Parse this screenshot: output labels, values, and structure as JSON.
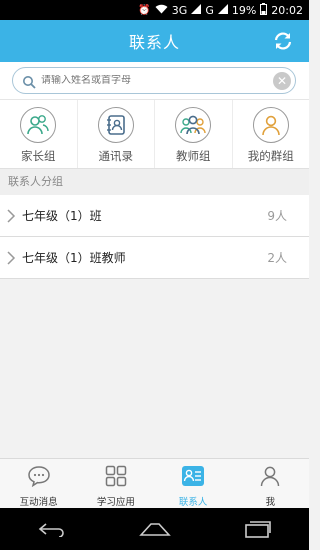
{
  "status": {
    "signal1": "3G",
    "signal2": "G",
    "battery": "19%",
    "time": "20:02"
  },
  "header": {
    "title": "联系人"
  },
  "search": {
    "placeholder": "请输入姓名或首字母",
    "value": ""
  },
  "categories": [
    {
      "label": "家长组",
      "icon": "parents-group-icon"
    },
    {
      "label": "通讯录",
      "icon": "address-book-icon"
    },
    {
      "label": "教师组",
      "icon": "teachers-group-icon"
    },
    {
      "label": "我的群组",
      "icon": "my-group-icon"
    }
  ],
  "section": {
    "title": "联系人分组"
  },
  "groups": [
    {
      "name": "七年级（1）班",
      "count": "9人"
    },
    {
      "name": "七年级（1）班教师",
      "count": "2人"
    }
  ],
  "tabs": [
    {
      "label": "互动消息",
      "icon": "chat-bubble-icon"
    },
    {
      "label": "学习应用",
      "icon": "apps-grid-icon"
    },
    {
      "label": "联系人",
      "icon": "contact-card-icon",
      "active": true
    },
    {
      "label": "我",
      "icon": "person-icon"
    }
  ],
  "colors": {
    "accent": "#3bb3e6"
  }
}
